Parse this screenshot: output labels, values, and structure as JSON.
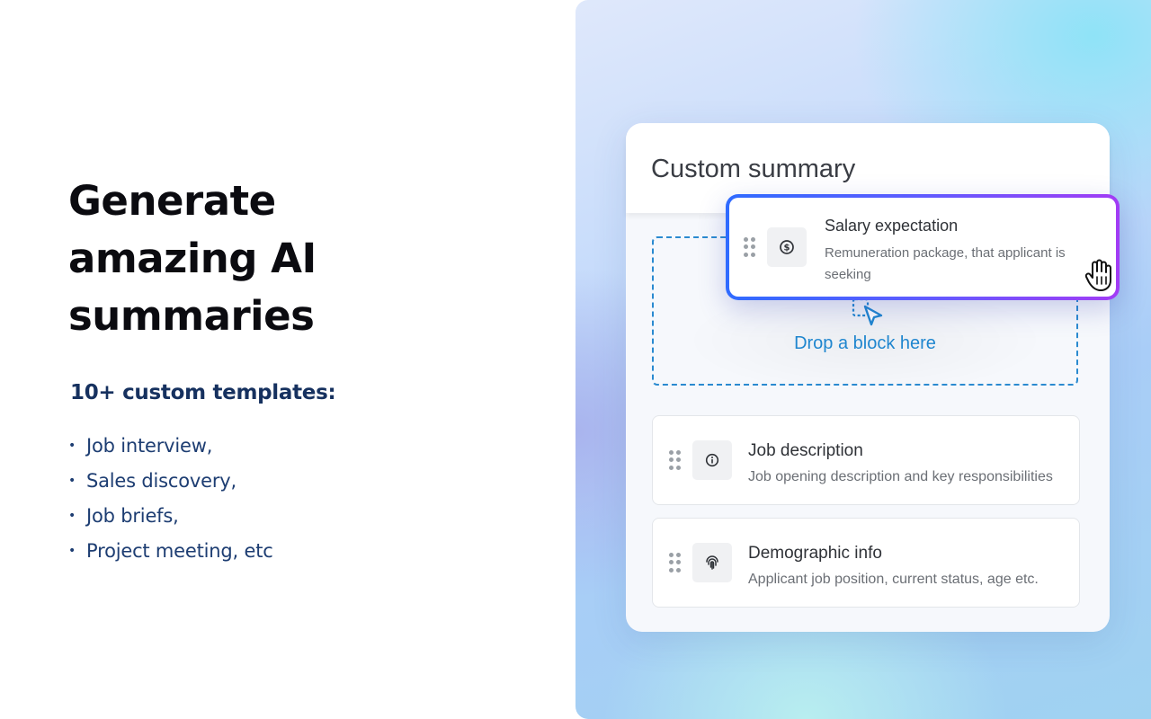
{
  "headline": "Generate amazing AI summaries",
  "subheading": "10+ custom templates:",
  "templates": [
    "Job interview,",
    "Sales discovery,",
    "Job briefs,",
    "Project meeting, etc"
  ],
  "bullet_char": "•",
  "card": {
    "title": "Custom summary",
    "dropzone_text": "Drop a block here",
    "dragged_block": {
      "title": "Salary expectation",
      "description": "Remuneration package, that applicant is seeking",
      "icon": "dollar-icon"
    },
    "blocks": [
      {
        "title": "Job description",
        "description": "Job opening description and key responsibilities",
        "icon": "info-icon"
      },
      {
        "title": "Demographic info",
        "description": "Applicant job position, current status, age etc.",
        "icon": "fingerprint-icon"
      }
    ]
  },
  "colors": {
    "headline": "#0b0b10",
    "subheading": "#16315f",
    "accent_blue": "#1f86cf",
    "drag_border_start": "#2f6bff",
    "drag_border_end": "#a23cf5"
  }
}
